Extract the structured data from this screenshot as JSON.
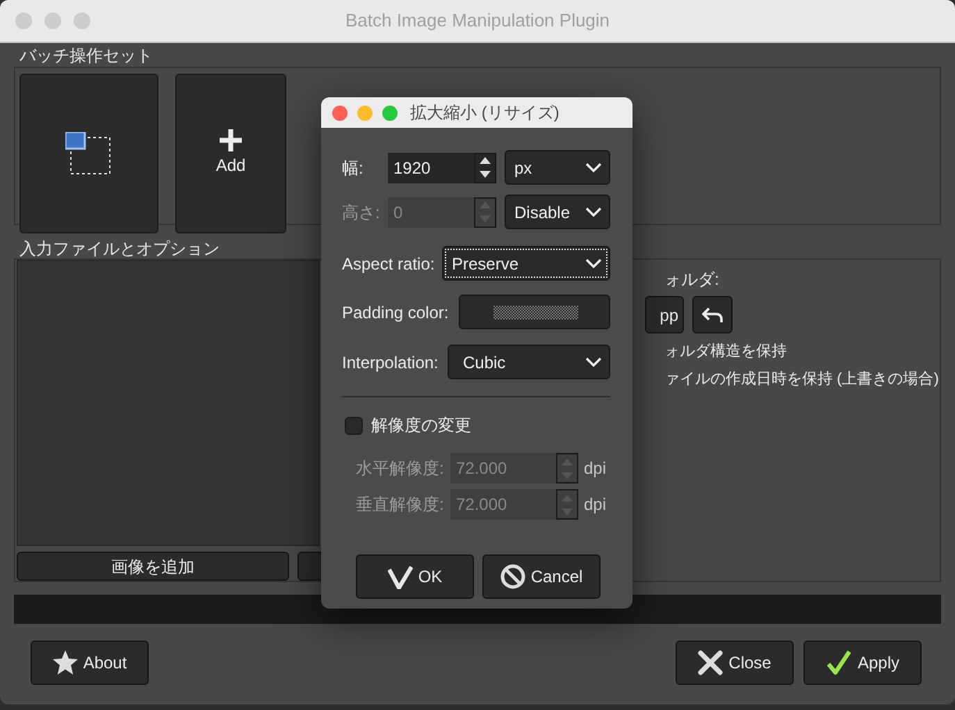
{
  "window": {
    "title": "Batch Image Manipulation Plugin"
  },
  "operation_set": {
    "label": "バッチ操作セット",
    "tiles": [
      {
        "kind": "operation"
      },
      {
        "kind": "add",
        "label": "Add"
      }
    ]
  },
  "input_section": {
    "label": "入力ファイルとオプション",
    "buttons": [
      "画像を追加"
    ]
  },
  "progress": {
    "level": 0
  },
  "output": {
    "label": "ォルダ:",
    "buttons": [
      {
        "kind": "text",
        "label": "pp"
      },
      {
        "kind": "undo"
      }
    ],
    "options": [
      "ォルダ構造を保持",
      "ァイルの作成日時を保持 (上書きの場合)"
    ]
  },
  "footer": {
    "buttons": [
      {
        "kind": "about",
        "label": "About"
      },
      {
        "kind": "close",
        "label": "Close"
      },
      {
        "kind": "apply",
        "label": "Apply"
      }
    ]
  },
  "dialog": {
    "title": "拡大縮小 (リサイズ)",
    "rows": [
      {
        "kind": "spin-select",
        "label": "幅:",
        "value": "1920",
        "unit": "px",
        "disabled": false
      },
      {
        "kind": "spin-select",
        "label": "高さ:",
        "value": "0",
        "unit": "Disable",
        "disabled": true
      },
      {
        "kind": "select",
        "label": "Aspect ratio:",
        "value": "Preserve",
        "focused": true
      },
      {
        "kind": "color",
        "label": "Padding color:"
      },
      {
        "kind": "select",
        "label": "Interpolation:",
        "value": "Cubic",
        "focused": false
      }
    ],
    "resolution": {
      "label": "解像度の変更",
      "checked": false,
      "rows": [
        {
          "label": "水平解像度:",
          "value": "72.000",
          "unit": "dpi",
          "disabled": true
        },
        {
          "label": "垂直解像度:",
          "value": "72.000",
          "unit": "dpi",
          "disabled": true
        }
      ]
    },
    "buttons": [
      {
        "kind": "ok",
        "label": "OK"
      },
      {
        "kind": "cancel",
        "label": "Cancel"
      }
    ]
  }
}
